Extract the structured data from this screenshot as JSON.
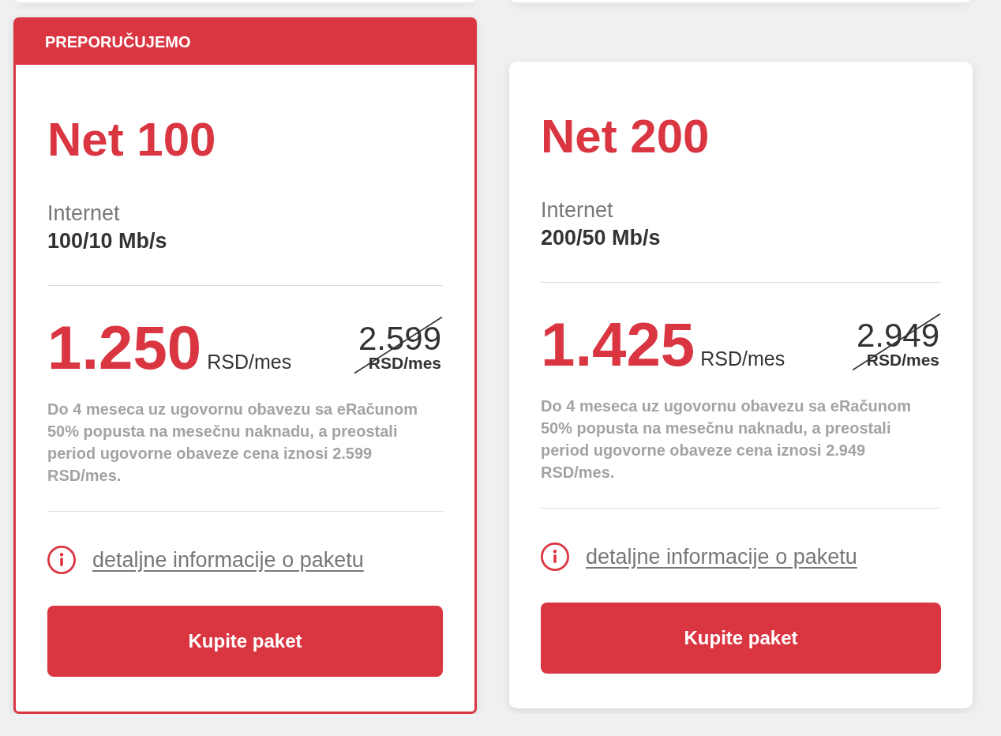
{
  "packages": [
    {
      "recommended": true,
      "badge": "PREPORUČUJEMO",
      "name": "Net 100",
      "service": "Internet",
      "speed": "100/10 Mb/s",
      "price": "1.250",
      "price_unit": "RSD/mes",
      "old_price": "2.599",
      "old_price_unit": "RSD/mes",
      "note": "Do 4 meseca uz ugovornu obavezu sa eRačunom 50% popusta na mesečnu naknadu, a preostali period ugovorne obaveze cena iznosi 2.599 RSD/mes.",
      "details_link": "detaljne informacije o paketu",
      "button": "Kupite paket"
    },
    {
      "recommended": false,
      "name": "Net 200",
      "service": "Internet",
      "speed": "200/50 Mb/s",
      "price": "1.425",
      "price_unit": "RSD/mes",
      "old_price": "2.949",
      "old_price_unit": "RSD/mes",
      "note": "Do 4 meseca uz ugovornu obavezu sa eRačunom 50% popusta na mesečnu naknadu, a preostali period ugovorne obaveze cena iznosi 2.949 RSD/mes.",
      "details_link": "detaljne informacije o paketu",
      "button": "Kupite paket"
    }
  ]
}
